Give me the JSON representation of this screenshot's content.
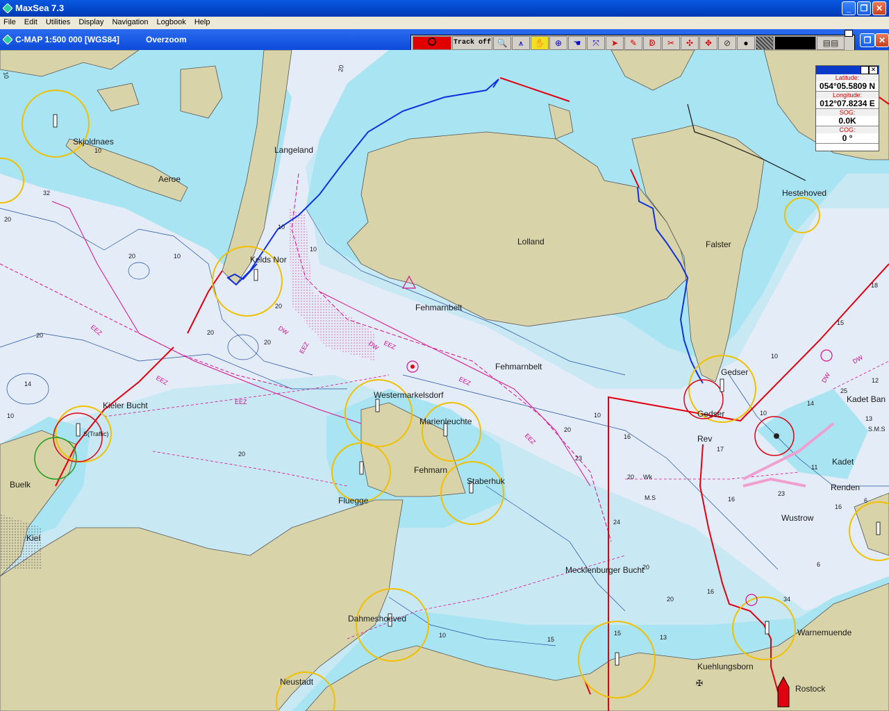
{
  "window": {
    "title": "MaxSea 7.3"
  },
  "menu": [
    "File",
    "Edit",
    "Utilities",
    "Display",
    "Navigation",
    "Logbook",
    "Help"
  ],
  "chart_header": {
    "source": "C-MAP  1:500 000 [WGS84]",
    "mode": "Overzoom"
  },
  "toolbar": {
    "track_label": "Track off"
  },
  "position": {
    "latitude_label": "Latitude:",
    "latitude": "054°05.5809 N",
    "longitude_label": "Longitude:",
    "longitude": "012°07.8234 E",
    "sog_label": "SOG:",
    "sog": "0.0K",
    "cog_label": "COG:",
    "cog": "0 °"
  },
  "places": {
    "skjoldnaes": "Skjoldnaes",
    "aeroe": "Aeroe",
    "langeland": "Langeland",
    "keldsnor": "Kelds Nor",
    "lolland": "Lolland",
    "falster": "Falster",
    "hesteh": "Hesteh",
    "hesteh_rest": "ved",
    "fehmarnbelt1": "Fehmarnbelt",
    "fehmarnbelt2": "Fehmarnbelt",
    "gedser": "Gedser",
    "gedser_rev": "Gedser",
    "rev": "Rev",
    "kadet_bank": "Kadet Ban",
    "kadet": "Kadet",
    "renden": "Renden",
    "wustrow": "Wustrow",
    "kieler_bucht": "Kieler Bucht",
    "buelk": "Buelk",
    "kiel": "Kiel",
    "westermarkelsdorf": "Westermarkelsdorf",
    "marienleuchte": "Marienleuchte",
    "fehmarn": "Fehmarn",
    "staberhuk": "Staberhuk",
    "fluegge": "Fluegge",
    "mecklenburger": "Mecklenburger Bucht",
    "dahmeshoeved": "Dahmeshoeved",
    "neustadt": "Neustadt",
    "warnemuende": "Warnemuende",
    "kuehlungsborn": "Kuehlungsborn",
    "rostock": "Rostock",
    "traffic": "S(Traffic)",
    "ms": "M.S",
    "sms": "S.M.S",
    "wk": "Wk"
  },
  "depths": {
    "d10a": "10",
    "d20a": "20",
    "d32": "32",
    "d10b": "10",
    "d20b": "20",
    "d10c": "10",
    "d10d": "10",
    "d20c": "20",
    "d20d": "20",
    "d10e": "10",
    "d20e": "20",
    "d20f": "20",
    "d14": "14",
    "d20g": "20",
    "d10f": "10",
    "d10g": "10",
    "d20h": "20",
    "d23": "23",
    "d24": "24",
    "d15a": "15",
    "d13": "13",
    "d15b": "15",
    "d16a": "16",
    "d17": "17",
    "d16b": "16",
    "d20i": "20",
    "d20j": "20",
    "d16c": "16",
    "d20k": "20",
    "d16d": "16",
    "d10h": "10",
    "d6a": "6",
    "d34": "34",
    "d14b": "14",
    "d25": "25",
    "d12": "12",
    "d13b": "13",
    "d11": "11",
    "d23b": "23",
    "d18": "18",
    "d10i": "10",
    "d20l": "20",
    "d15c": "15",
    "d10j": "10",
    "d6b": "6"
  },
  "chart_marks": {
    "dw1": "DW",
    "dw2": "DW",
    "dw3": "DW",
    "dw4": "DW",
    "eez1": "EEZ",
    "eez2": "EEZ",
    "eez3": "EEZ",
    "eez4": "EEZ",
    "eez5": "EEZ",
    "eez6": "EEZ",
    "eez7": "EEZ"
  },
  "colors": {
    "land": "#d8d3a8",
    "shallow": "#a8e4f2",
    "deep": "#e4ecf8",
    "medium": "#c8e8f4",
    "track_blue": "#1030e0",
    "route_red": "#e00010",
    "light_circle": "#f0c000",
    "magenta": "#d8108c"
  }
}
